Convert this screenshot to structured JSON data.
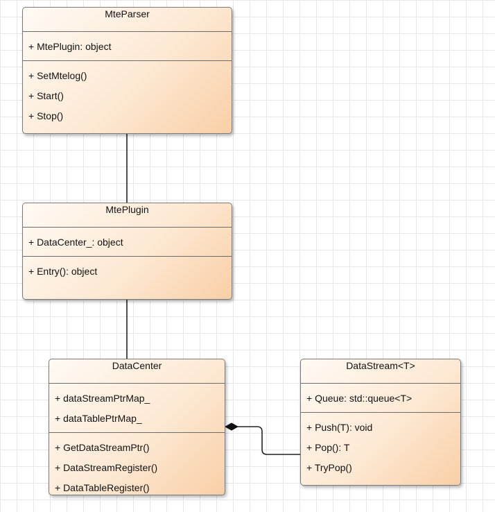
{
  "classes": {
    "mteparser": {
      "name": "MteParser",
      "attributes": [
        "+ MtePlugin: object"
      ],
      "operations": [
        "+ SetMtelog()",
        "+ Start()",
        "+ Stop()"
      ]
    },
    "mteplugin": {
      "name": "MtePlugin",
      "attributes": [
        "+ DataCenter_: object"
      ],
      "operations": [
        "+ Entry(): object"
      ]
    },
    "datacenter": {
      "name": "DataCenter",
      "attributes": [
        "+ dataStreamPtrMap_",
        "+ dataTablePtrMap_"
      ],
      "operations": [
        "+ GetDataStreamPtr()",
        "+ DataStreamRegister()",
        "+ DataTableRegister()"
      ]
    },
    "datastream": {
      "name": "DataStream<T>",
      "attributes": [
        "+ Queue: std::queue<T>"
      ],
      "operations": [
        "+ Push(T): void",
        "+ Pop(): T",
        "+ TryPop()"
      ]
    }
  },
  "relationships": [
    {
      "from": "mteparser",
      "to": "mteplugin",
      "kind": "association"
    },
    {
      "from": "mteplugin",
      "to": "datacenter",
      "kind": "association"
    },
    {
      "from": "datacenter",
      "to": "datastream",
      "kind": "composition"
    }
  ]
}
